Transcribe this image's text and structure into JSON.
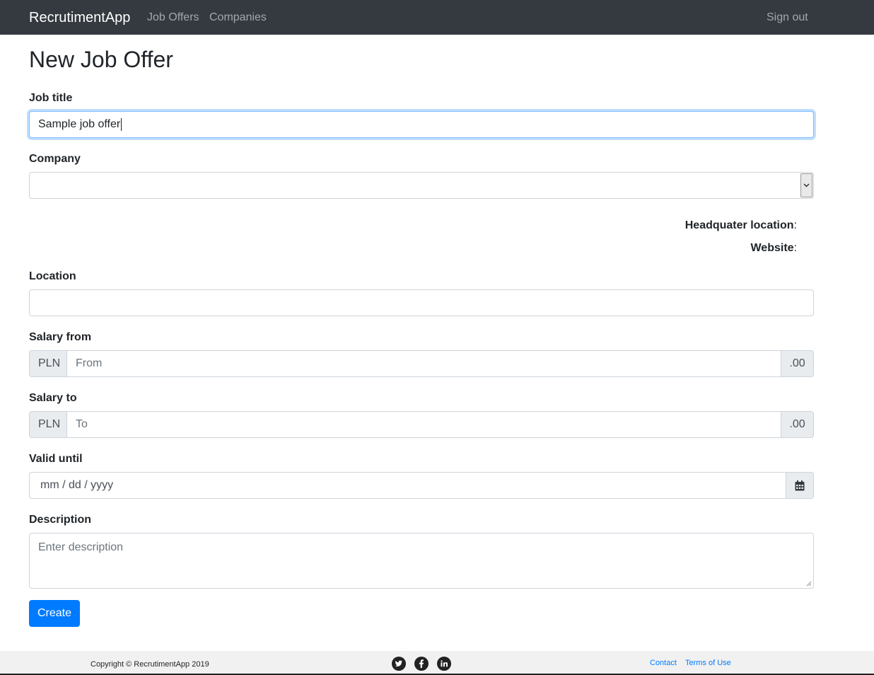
{
  "navbar": {
    "brand": "RecrutimentApp",
    "links": [
      {
        "label": "Job Offers"
      },
      {
        "label": "Companies"
      }
    ],
    "sign_out": "Sign out"
  },
  "page": {
    "title": "New Job Offer"
  },
  "form": {
    "job_title": {
      "label": "Job title",
      "value": "Sample job offer"
    },
    "company": {
      "label": "Company",
      "value": ""
    },
    "company_info": {
      "headquarter_label": "Headquater location",
      "website_label": "Website",
      "colon": ":"
    },
    "location": {
      "label": "Location",
      "value": ""
    },
    "salary_from": {
      "label": "Salary from",
      "prefix": "PLN",
      "placeholder": "From",
      "suffix": ".00"
    },
    "salary_to": {
      "label": "Salary to",
      "prefix": "PLN",
      "placeholder": "To",
      "suffix": ".00"
    },
    "valid_until": {
      "label": "Valid until",
      "placeholder": "mm / dd / yyyy"
    },
    "description": {
      "label": "Description",
      "placeholder": "Enter description"
    },
    "submit_label": "Create"
  },
  "footer": {
    "copyright": "Copyright © RecrutimentApp 2019",
    "social": [
      "twitter-icon",
      "facebook-icon",
      "linkedin-icon"
    ],
    "links": [
      {
        "label": "Contact"
      },
      {
        "label": "Terms of Use"
      }
    ]
  },
  "colors": {
    "navbar_bg": "#343a40",
    "primary": "#007bff",
    "footer_bg": "#f1f1f1"
  }
}
